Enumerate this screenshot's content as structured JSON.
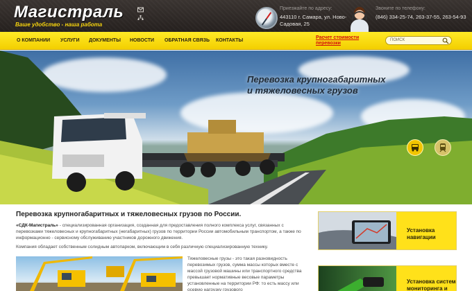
{
  "header": {
    "logo": "Магистраль",
    "slogan": "Ваше удобство - наша работа",
    "address_label": "Приезжайте по адресу:",
    "address": "443110 г. Самара, ул. Ново-Садовая, 25",
    "phone_label": "Звоните по телефону:",
    "phones": "(846) 334-25-74, 263-37-55, 263-54-93"
  },
  "nav": {
    "items": [
      "О компании",
      "Услуги",
      "Документы",
      "Новости",
      "Обратная связь",
      "Контакты"
    ],
    "calc_line1": "Расчет стоимости",
    "calc_line2": "перевозки",
    "search_placeholder": "ПОИСК"
  },
  "hero": {
    "title_line1": "Перевозка крупногабаритных",
    "title_line2": "и тяжеловесных грузов",
    "buttons": [
      {
        "icon": "truck-icon",
        "color": "#f2c500"
      },
      {
        "icon": "train-icon",
        "color": "#f2c500"
      }
    ]
  },
  "content": {
    "title": "Перевозка крупногабаритных и тяжеловесных грузов по России.",
    "para1_company": "«СДК-Магистраль»",
    "para1_text": " - специализированная организация, созданная для предоставления полного комплекса услуг, связанных с перевозками тяжеловесных и крупногабаритных (негабаритных) грузов по территории России автомобильным транспортом, а также по информационно - сервисному обслуживанию участников дорожного движения.",
    "para2": "Компания обладает собственным солидным автопарком, включающим в себя различную специализированную технику.",
    "para3": "Тяжеловесные грузы - это такая разновидность перевозимых грузов, сумма массы которых вместе с массой грузовой машины или транспортного средства превышает нормативные весовые параметры установленные на территории РФ: то есть массу или осевую нагрузку грузового"
  },
  "sidebar": {
    "cards": [
      {
        "line1": "Установка",
        "line2": "навигации"
      },
      {
        "line1": "Установка систем",
        "line2": "мониторинга и"
      }
    ]
  },
  "colors": {
    "accent_yellow": "#f5d20e",
    "nav_red": "#d20b0b",
    "header_dark": "#2b2624"
  }
}
